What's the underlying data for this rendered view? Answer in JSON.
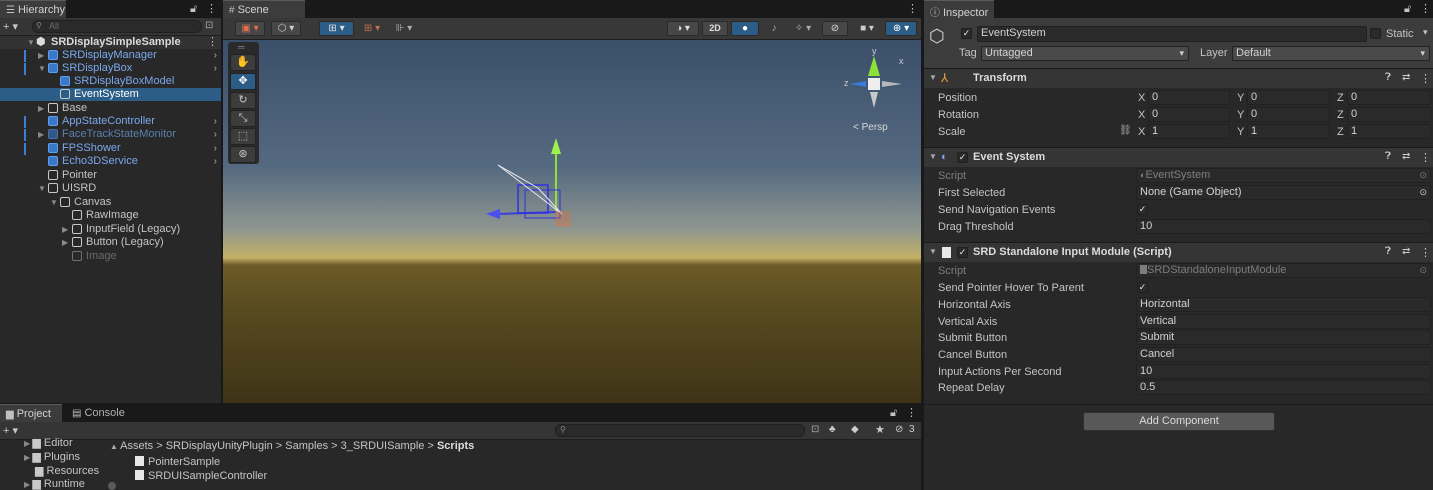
{
  "hierarchy": {
    "tab_label": "Hierarchy",
    "add_label": "+ ▾",
    "search_placeholder": "All",
    "items": [
      {
        "label": "SRDisplaySimpleSample"
      },
      {
        "label": "SRDisplayManager"
      },
      {
        "label": "SRDisplayBox"
      },
      {
        "label": "SRDisplayBoxModel"
      },
      {
        "label": "EventSystem"
      },
      {
        "label": "Base"
      },
      {
        "label": "AppStateController"
      },
      {
        "label": "FaceTrackStateMonitor"
      },
      {
        "label": "FPSShower"
      },
      {
        "label": "Echo3DService"
      },
      {
        "label": "Pointer"
      },
      {
        "label": "UISRD"
      },
      {
        "label": "Canvas"
      },
      {
        "label": "RawImage"
      },
      {
        "label": "InputField (Legacy)"
      },
      {
        "label": "Button (Legacy)"
      },
      {
        "label": "Image"
      }
    ]
  },
  "scene": {
    "tab_label": "Scene",
    "toolbar": {
      "mode_2d": "2D"
    },
    "persp_label": "< Persp",
    "axis_y": "y",
    "axis_z": "z",
    "axis_x": "x",
    "colors": {
      "sky_top": "#3a4f6a",
      "sky_mid": "#7d8e96",
      "horizon": "#c4b066",
      "ground_top": "#5c4d22",
      "ground_bottom": "#3e3316",
      "selection_tab": "#2c5d87"
    }
  },
  "project": {
    "tabs": [
      {
        "label": "Project"
      },
      {
        "label": "Console"
      }
    ],
    "add_label": "+ ▾",
    "filter_count": "3",
    "folders": [
      {
        "label": "Editor"
      },
      {
        "label": "Plugins"
      },
      {
        "label": "Resources"
      },
      {
        "label": "Runtime"
      }
    ],
    "breadcrumb": {
      "parts": [
        "Assets",
        "SRDisplayUnityPlugin",
        "Samples",
        "3_SRDUISample"
      ],
      "current": "Scripts",
      "sep": ">"
    },
    "files": [
      {
        "label": "PointerSample"
      },
      {
        "label": "SRDUISampleController"
      }
    ]
  },
  "inspector": {
    "tab_label": "Inspector",
    "object_name": "EventSystem",
    "static_label": "Static",
    "tag_label": "Tag",
    "tag_value": "Untagged",
    "layer_label": "Layer",
    "layer_value": "Default",
    "transform": {
      "title": "Transform",
      "rows": [
        {
          "label": "Position",
          "x": "0",
          "y": "0",
          "z": "0"
        },
        {
          "label": "Rotation",
          "x": "0",
          "y": "0",
          "z": "0"
        },
        {
          "label": "Scale",
          "x": "1",
          "y": "1",
          "z": "1"
        }
      ],
      "x_label": "X",
      "y_label": "Y",
      "z_label": "Z"
    },
    "event_system": {
      "title": "Event System",
      "script_label": "Script",
      "script_value": "EventSystem",
      "first_selected_label": "First Selected",
      "first_selected_value": "None (Game Object)",
      "send_nav_label": "Send Navigation Events",
      "send_nav_value": "✓",
      "drag_threshold_label": "Drag Threshold",
      "drag_threshold_value": "10"
    },
    "srd_module": {
      "title": "SRD Standalone Input Module (Script)",
      "script_label": "Script",
      "script_value": "SRDStandaloneInputModule",
      "send_hover_label": "Send Pointer Hover To Parent",
      "send_hover_value": "✓",
      "horizontal_axis_label": "Horizontal Axis",
      "horizontal_axis_value": "Horizontal",
      "vertical_axis_label": "Vertical Axis",
      "vertical_axis_value": "Vertical",
      "submit_label": "Submit Button",
      "submit_value": "Submit",
      "cancel_label": "Cancel Button",
      "cancel_value": "Cancel",
      "input_actions_label": "Input Actions Per Second",
      "input_actions_value": "10",
      "repeat_delay_label": "Repeat Delay",
      "repeat_delay_value": "0.5"
    },
    "add_component_label": "Add Component"
  }
}
